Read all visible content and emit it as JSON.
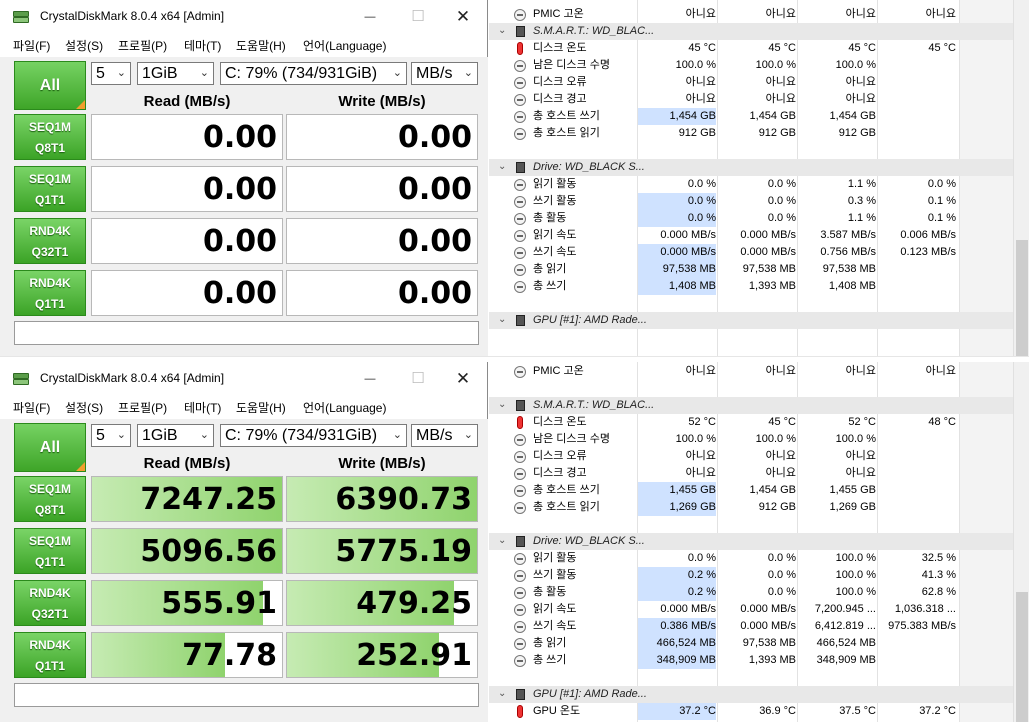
{
  "windows": [
    {
      "title": "CrystalDiskMark 8.0.4 x64 [Admin]",
      "menu": [
        "파일(F)",
        "설정(S)",
        "프로필(P)",
        "테마(T)",
        "도움말(H)",
        "언어(Language)"
      ],
      "all_label": "All",
      "count": "5",
      "size": "1GiB",
      "drive": "C: 79% (734/931GiB)",
      "unit": "MB/s",
      "read_header": "Read (MB/s)",
      "write_header": "Write (MB/s)",
      "tests": [
        {
          "l1": "SEQ1M",
          "l2": "Q8T1",
          "read": "0.00",
          "write": "0.00",
          "read_fill": 0,
          "write_fill": 0
        },
        {
          "l1": "SEQ1M",
          "l2": "Q1T1",
          "read": "0.00",
          "write": "0.00",
          "read_fill": 0,
          "write_fill": 0
        },
        {
          "l1": "RND4K",
          "l2": "Q32T1",
          "read": "0.00",
          "write": "0.00",
          "read_fill": 0,
          "write_fill": 0
        },
        {
          "l1": "RND4K",
          "l2": "Q1T1",
          "read": "0.00",
          "write": "0.00",
          "read_fill": 0,
          "write_fill": 0
        }
      ],
      "status": ""
    },
    {
      "title": "CrystalDiskMark 8.0.4 x64 [Admin]",
      "menu": [
        "파일(F)",
        "설정(S)",
        "프로필(P)",
        "테마(T)",
        "도움말(H)",
        "언어(Language)"
      ],
      "all_label": "All",
      "count": "5",
      "size": "1GiB",
      "drive": "C: 79% (734/931GiB)",
      "unit": "MB/s",
      "read_header": "Read (MB/s)",
      "write_header": "Write (MB/s)",
      "tests": [
        {
          "l1": "SEQ1M",
          "l2": "Q8T1",
          "read": "7247.25",
          "write": "6390.73",
          "read_fill": 1.0,
          "write_fill": 1.0
        },
        {
          "l1": "SEQ1M",
          "l2": "Q1T1",
          "read": "5096.56",
          "write": "5775.19",
          "read_fill": 1.0,
          "write_fill": 1.0
        },
        {
          "l1": "RND4K",
          "l2": "Q32T1",
          "read": "555.91",
          "write": "479.25",
          "read_fill": 0.9,
          "write_fill": 0.88
        },
        {
          "l1": "RND4K",
          "l2": "Q1T1",
          "read": "77.78",
          "write": "252.91",
          "read_fill": 0.7,
          "write_fill": 0.8
        }
      ],
      "status": ""
    }
  ],
  "hwinfo": [
    {
      "rows": [
        {
          "type": "sensor",
          "label": "PMIC 고온",
          "v": [
            "아니요",
            "아니요",
            "아니요",
            "아니요"
          ]
        },
        {
          "type": "section",
          "label": "S.M.A.R.T.: WD_BLAC..."
        },
        {
          "type": "temp",
          "label": "디스크 온도",
          "v": [
            "45 °C",
            "45 °C",
            "45 °C",
            "45 °C"
          ]
        },
        {
          "type": "sensor",
          "label": "남은 디스크 수명",
          "v": [
            "100.0 %",
            "100.0 %",
            "100.0 %",
            ""
          ]
        },
        {
          "type": "sensor",
          "label": "디스크 오류",
          "v": [
            "아니요",
            "아니요",
            "아니요",
            ""
          ]
        },
        {
          "type": "sensor",
          "label": "디스크 경고",
          "v": [
            "아니요",
            "아니요",
            "아니요",
            ""
          ]
        },
        {
          "type": "sensor",
          "label": "총 호스트 쓰기",
          "v": [
            "1,454 GB",
            "1,454 GB",
            "1,454 GB",
            ""
          ],
          "hl": true
        },
        {
          "type": "sensor",
          "label": "총 호스트 읽기",
          "v": [
            "912 GB",
            "912 GB",
            "912 GB",
            ""
          ]
        },
        {
          "type": "blank"
        },
        {
          "type": "section",
          "label": "Drive: WD_BLACK S..."
        },
        {
          "type": "sensor",
          "label": "읽기 활동",
          "v": [
            "0.0 %",
            "0.0 %",
            "1.1 %",
            "0.0 %"
          ]
        },
        {
          "type": "sensor",
          "label": "쓰기 활동",
          "v": [
            "0.0 %",
            "0.0 %",
            "0.3 %",
            "0.1 %"
          ],
          "hl": true
        },
        {
          "type": "sensor",
          "label": "총 활동",
          "v": [
            "0.0 %",
            "0.0 %",
            "1.1 %",
            "0.1 %"
          ],
          "hl": true
        },
        {
          "type": "sensor",
          "label": "읽기 속도",
          "v": [
            "0.000 MB/s",
            "0.000 MB/s",
            "3.587 MB/s",
            "0.006 MB/s"
          ]
        },
        {
          "type": "sensor",
          "label": "쓰기 속도",
          "v": [
            "0.000 MB/s",
            "0.000 MB/s",
            "0.756 MB/s",
            "0.123 MB/s"
          ],
          "hl": true
        },
        {
          "type": "sensor",
          "label": "총 읽기",
          "v": [
            "97,538 MB",
            "97,538 MB",
            "97,538 MB",
            ""
          ],
          "hl": true
        },
        {
          "type": "sensor",
          "label": "총 쓰기",
          "v": [
            "1,408 MB",
            "1,393 MB",
            "1,408 MB",
            ""
          ],
          "hl": true
        },
        {
          "type": "blank"
        },
        {
          "type": "section",
          "label": "GPU [#1]: AMD Rade..."
        }
      ]
    },
    {
      "rows": [
        {
          "type": "sensor",
          "label": "PMIC 고온",
          "v": [
            "아니요",
            "아니요",
            "아니요",
            "아니요"
          ]
        },
        {
          "type": "blank"
        },
        {
          "type": "section",
          "label": "S.M.A.R.T.: WD_BLAC..."
        },
        {
          "type": "temp",
          "label": "디스크 온도",
          "v": [
            "52 °C",
            "45 °C",
            "52 °C",
            "48 °C"
          ]
        },
        {
          "type": "sensor",
          "label": "남은 디스크 수명",
          "v": [
            "100.0 %",
            "100.0 %",
            "100.0 %",
            ""
          ]
        },
        {
          "type": "sensor",
          "label": "디스크 오류",
          "v": [
            "아니요",
            "아니요",
            "아니요",
            ""
          ]
        },
        {
          "type": "sensor",
          "label": "디스크 경고",
          "v": [
            "아니요",
            "아니요",
            "아니요",
            ""
          ]
        },
        {
          "type": "sensor",
          "label": "총 호스트 쓰기",
          "v": [
            "1,455 GB",
            "1,454 GB",
            "1,455 GB",
            ""
          ],
          "hl": true
        },
        {
          "type": "sensor",
          "label": "총 호스트 읽기",
          "v": [
            "1,269 GB",
            "912 GB",
            "1,269 GB",
            ""
          ],
          "hl": true
        },
        {
          "type": "blank"
        },
        {
          "type": "section",
          "label": "Drive: WD_BLACK S..."
        },
        {
          "type": "sensor",
          "label": "읽기 활동",
          "v": [
            "0.0 %",
            "0.0 %",
            "100.0 %",
            "32.5 %"
          ]
        },
        {
          "type": "sensor",
          "label": "쓰기 활동",
          "v": [
            "0.2 %",
            "0.0 %",
            "100.0 %",
            "41.3 %"
          ],
          "hl": true
        },
        {
          "type": "sensor",
          "label": "총 활동",
          "v": [
            "0.2 %",
            "0.0 %",
            "100.0 %",
            "62.8 %"
          ],
          "hl": true
        },
        {
          "type": "sensor",
          "label": "읽기 속도",
          "v": [
            "0.000 MB/s",
            "0.000 MB/s",
            "7,200.945 ...",
            "1,036.318 ..."
          ]
        },
        {
          "type": "sensor",
          "label": "쓰기 속도",
          "v": [
            "0.386 MB/s",
            "0.000 MB/s",
            "6,412.819 ...",
            "975.383 MB/s"
          ],
          "hl": true
        },
        {
          "type": "sensor",
          "label": "총 읽기",
          "v": [
            "466,524 MB",
            "97,538 MB",
            "466,524 MB",
            ""
          ],
          "hl": true
        },
        {
          "type": "sensor",
          "label": "총 쓰기",
          "v": [
            "348,909 MB",
            "1,393 MB",
            "348,909 MB",
            ""
          ],
          "hl": true
        },
        {
          "type": "blank"
        },
        {
          "type": "section",
          "label": "GPU [#1]: AMD Rade..."
        },
        {
          "type": "temp",
          "label": "GPU 온도",
          "v": [
            "37.2 °C",
            "36.9 °C",
            "37.5 °C",
            "37.2 °C"
          ],
          "hl": true
        }
      ]
    }
  ],
  "colors": {
    "accent_green": "#3ea528",
    "bar_fill": "#8fd36d",
    "highlight": "#cfe2ff"
  }
}
